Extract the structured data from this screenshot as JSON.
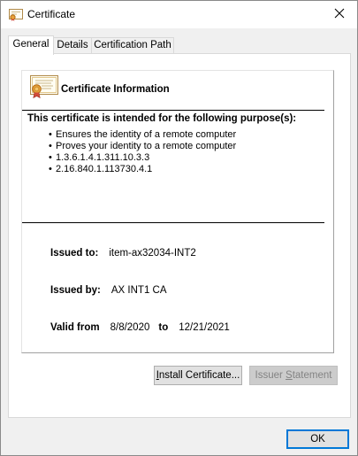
{
  "window": {
    "title": "Certificate",
    "close_glyph": "✕"
  },
  "tabs": [
    {
      "label": "General",
      "active": true
    },
    {
      "label": "Details",
      "active": false
    },
    {
      "label": "Certification Path",
      "active": false
    }
  ],
  "info": {
    "heading": "Certificate Information",
    "purpose_title": "This certificate is intended for the following purpose(s):",
    "purposes": [
      "Ensures the identity of a remote computer",
      "Proves your identity to a remote computer",
      "1.3.6.1.4.1.311.10.3.3",
      "2.16.840.1.113730.4.1"
    ],
    "issued_to_label": "Issued to:",
    "issued_to": "item-ax32034-INT2",
    "issued_by_label": "Issued by:",
    "issued_by": "AX INT1 CA",
    "valid_from_label": "Valid from",
    "valid_from": "8/8/2020",
    "to_label": "to",
    "valid_to": "12/21/2021"
  },
  "buttons": {
    "install": {
      "pre": "",
      "u": "I",
      "post": "nstall Certificate..."
    },
    "issuer_statement": {
      "pre": "Issuer ",
      "u": "S",
      "post": "tatement"
    },
    "ok": "OK"
  },
  "icons": {
    "title": "certificate-icon",
    "cert": "certificate-ribbon-icon",
    "close": "close-icon"
  },
  "colors": {
    "accent": "#0078d7",
    "ribbon": "#e8a23a",
    "seal": "#d69a2d"
  }
}
